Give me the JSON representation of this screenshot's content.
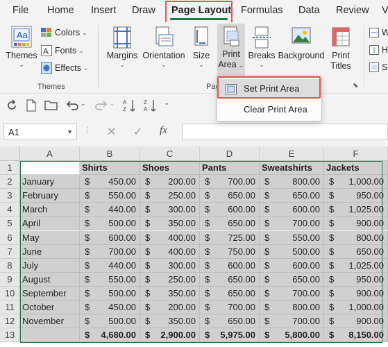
{
  "tabs": [
    "File",
    "Home",
    "Insert",
    "Draw",
    "Page Layout",
    "Formulas",
    "Data",
    "Review",
    "V"
  ],
  "ribbon": {
    "themes": {
      "themes": "Themes",
      "colors": "Colors",
      "fonts": "Fonts",
      "effects": "Effects",
      "group": "Themes"
    },
    "page_setup": {
      "margins": "Margins",
      "orientation": "Orientation",
      "size": "Size",
      "print_area_1": "Print",
      "print_area_2": "Area",
      "breaks": "Breaks",
      "background": "Background",
      "print_titles_1": "Print",
      "print_titles_2": "Titles",
      "group": "Pag"
    },
    "scale": {
      "w": "W",
      "h": "H",
      "s": "S"
    }
  },
  "dropdown": {
    "set_print_area": "Set Print Area",
    "clear_print_area": "Clear Print Area"
  },
  "namebox": "A1",
  "fx": "fx",
  "sheet": {
    "columns": [
      "A",
      "B",
      "C",
      "D",
      "E",
      "F"
    ],
    "rows": [
      "1",
      "2",
      "3",
      "4",
      "5",
      "6",
      "7",
      "8",
      "9",
      "10",
      "11",
      "12",
      "13"
    ],
    "headers": [
      "",
      "Shirts",
      "Shoes",
      "Pants",
      "Sweatshirts",
      "Jackets"
    ],
    "data": [
      [
        "January",
        "450.00",
        "200.00",
        "700.00",
        "800.00",
        "1,000.00"
      ],
      [
        "February",
        "550.00",
        "250.00",
        "650.00",
        "650.00",
        "950.00"
      ],
      [
        "March",
        "440.00",
        "300.00",
        "600.00",
        "600.00",
        "1,025.00"
      ],
      [
        "April",
        "500.00",
        "350.00",
        "650.00",
        "700.00",
        "900.00"
      ],
      [
        "May",
        "600.00",
        "400.00",
        "725.00",
        "550.00",
        "800.00"
      ],
      [
        "June",
        "700.00",
        "400.00",
        "750.00",
        "500.00",
        "650.00"
      ],
      [
        "July",
        "440.00",
        "300.00",
        "600.00",
        "600.00",
        "1,025.00"
      ],
      [
        "August",
        "550.00",
        "250.00",
        "650.00",
        "650.00",
        "950.00"
      ],
      [
        "September",
        "500.00",
        "350.00",
        "650.00",
        "700.00",
        "900.00"
      ],
      [
        "October",
        "450.00",
        "200.00",
        "700.00",
        "800.00",
        "1,000.00"
      ],
      [
        "November",
        "500.00",
        "350.00",
        "650.00",
        "700.00",
        "900.00"
      ]
    ],
    "totals": [
      "",
      "4,680.00",
      "2,900.00",
      "5,975.00",
      "5,800.00",
      "8,150.00"
    ],
    "currency": "$"
  },
  "colors": {
    "accent_green": "#217346",
    "highlight_red": "#e8544d"
  }
}
